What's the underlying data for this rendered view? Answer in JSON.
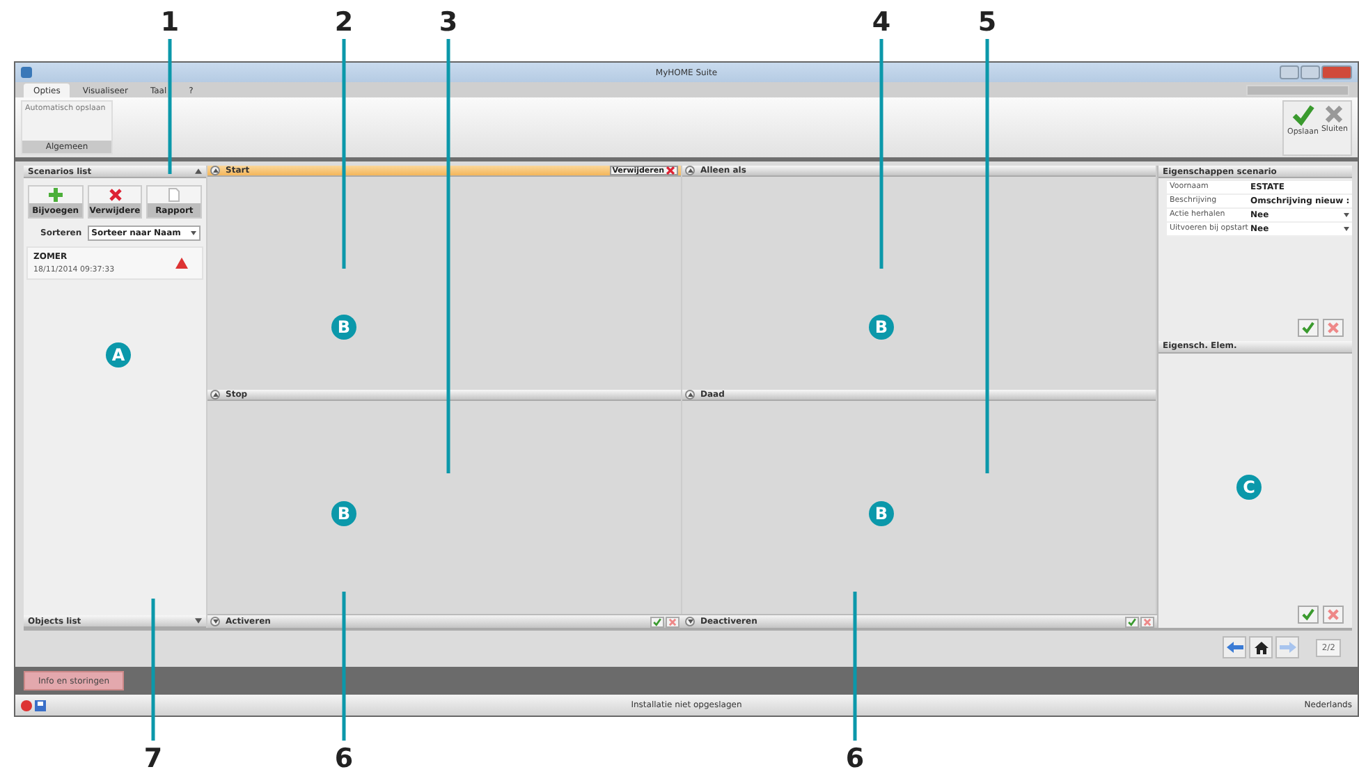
{
  "window": {
    "title": "MyHOME Suite"
  },
  "menu_tabs": [
    {
      "label": "Opties",
      "selected": true
    },
    {
      "label": "Visualiseer",
      "selected": false
    },
    {
      "label": "Taal",
      "selected": false
    },
    {
      "label": "?",
      "selected": false
    }
  ],
  "ribbon": {
    "group_item": "Automatisch opslaan",
    "group_label": "Algemeen",
    "buttons": [
      {
        "kind": "save",
        "label": "Opslaan"
      },
      {
        "kind": "close",
        "label": "Sluiten"
      }
    ]
  },
  "scenarios_list": {
    "title": "Scenarios list",
    "buttons": [
      {
        "kind": "add",
        "label": "Bijvoegen"
      },
      {
        "kind": "delete",
        "label": "Verwijdere"
      },
      {
        "kind": "report",
        "label": "Rapport"
      }
    ],
    "sort_label": "Sorteren",
    "sort_value": "Sorteer naar Naam",
    "items": [
      {
        "name": "ZOMER",
        "date": "18/11/2014 09:37:33"
      }
    ]
  },
  "objects_list": {
    "title": "Objects list"
  },
  "sections": [
    {
      "title": "Start",
      "selected": true,
      "expanded": true,
      "delete_label": "Verwijderen"
    },
    {
      "title": "Alleen als",
      "selected": false,
      "expanded": true
    },
    {
      "title": "Stop",
      "selected": false,
      "expanded": true
    },
    {
      "title": "Daad",
      "selected": false,
      "expanded": true
    }
  ],
  "action_bars": [
    {
      "title": "Activeren",
      "expanded": false
    },
    {
      "title": "Deactiveren",
      "expanded": false
    }
  ],
  "scenario_properties": {
    "title": "Eigenschappen scenario",
    "rows": [
      {
        "label": "Voornaam",
        "value": "ESTATE",
        "kind": "text"
      },
      {
        "label": "Beschrijving",
        "value": "Omschrijving nieuw :",
        "kind": "text"
      },
      {
        "label": "Actie herhalen",
        "value": "Nee",
        "kind": "dropdown"
      },
      {
        "label": "Uitvoeren bij opstart",
        "value": "Nee",
        "kind": "dropdown"
      }
    ]
  },
  "element_properties": {
    "title": "Eigensch. Elem."
  },
  "page_indicator": "2/2",
  "info_button": "Info en storingen",
  "status_bar": {
    "message": "Installatie niet opgeslagen",
    "language": "Nederlands"
  },
  "callouts": [
    {
      "label": "1"
    },
    {
      "label": "2"
    },
    {
      "label": "3"
    },
    {
      "label": "4"
    },
    {
      "label": "5"
    },
    {
      "label": "7"
    },
    {
      "label": "6"
    },
    {
      "label": "6"
    }
  ],
  "area_markers": [
    {
      "label": "A"
    },
    {
      "label": "B"
    },
    {
      "label": "B"
    },
    {
      "label": "B"
    },
    {
      "label": "B"
    },
    {
      "label": "C"
    }
  ]
}
